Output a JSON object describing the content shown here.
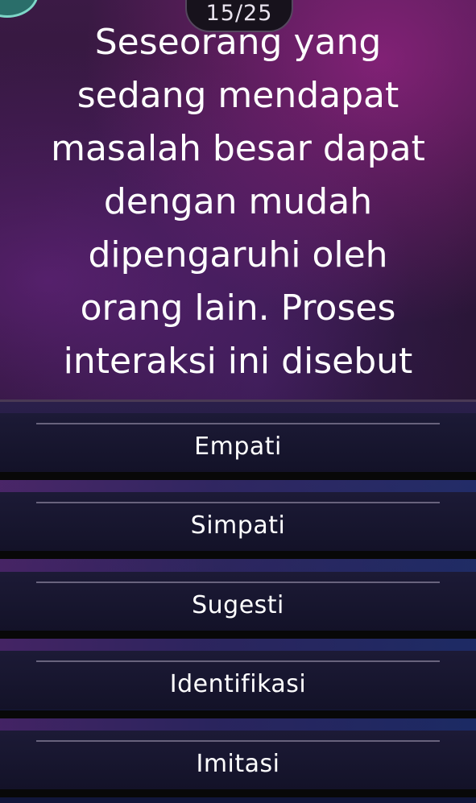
{
  "header": {
    "progress_counter": "15/25"
  },
  "question": {
    "text": "Seseorang yang\nsedang mendapat\nmasalah besar dapat\ndengan mudah\ndipengaruhi oleh\norang lain. Proses\ninteraksi ini disebut"
  },
  "options": [
    {
      "label": "Empati"
    },
    {
      "label": "Simpati"
    },
    {
      "label": "Sugesti"
    },
    {
      "label": "Identifikasi"
    },
    {
      "label": "Imitasi"
    }
  ],
  "colors": {
    "question_bg": "#2d1638",
    "option_bg": "#131228",
    "accent_purple": "#6a2d86",
    "accent_blue": "#233a86"
  }
}
